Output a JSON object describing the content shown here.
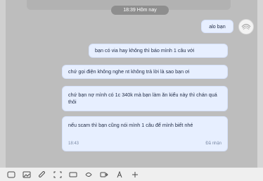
{
  "chat": {
    "timestamp": "18:39 Hôm nay",
    "messages": [
      {
        "text": "alo bạn"
      },
      {
        "text": "bạn có via hay không thì báo mình 1 câu với"
      },
      {
        "text": "chứ gọi điện không nghe nt không trả lời là sao bạn ơi"
      },
      {
        "text": "chứ bạn nợ mình có 1c 340k mà bạn làm ăn kiểu này thì chán quá thôi"
      },
      {
        "text": "nếu scam thì  bạn cũng nói mình 1 câu để mình biết nhé",
        "time": "18:43",
        "status": "Đã nhận"
      }
    ]
  },
  "toolbar": {
    "icons": [
      "sticker-icon",
      "image-icon",
      "attachment-icon",
      "screenshot-icon",
      "card-icon",
      "format-icon",
      "forward-icon",
      "font-icon",
      "more-icon"
    ]
  }
}
